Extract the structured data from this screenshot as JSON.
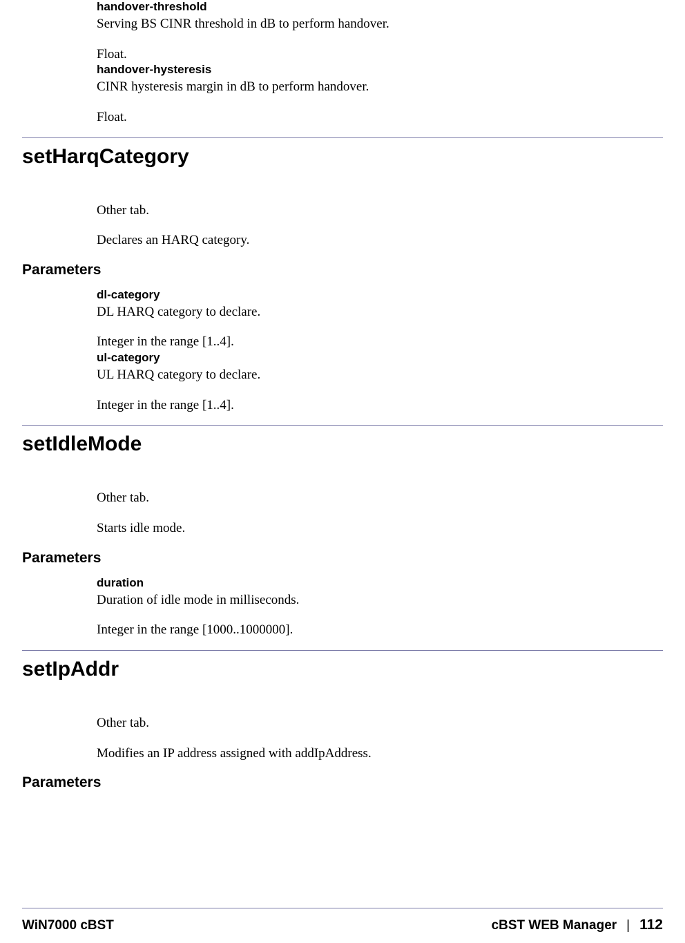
{
  "intro_params": [
    {
      "name": "handover-threshold",
      "desc": "Serving BS CINR threshold in dB to perform handover.",
      "type": "Float."
    },
    {
      "name": "handover-hysteresis",
      "desc": "CINR hysteresis margin in dB to perform handover.",
      "type": "Float."
    }
  ],
  "sections": [
    {
      "title": "setHarqCategory",
      "intro": [
        "Other tab.",
        "Declares an HARQ category."
      ],
      "params_heading": "Parameters",
      "params": [
        {
          "name": "dl-category",
          "desc": "DL HARQ category to declare.",
          "type": "Integer in the range [1..4]."
        },
        {
          "name": "ul-category",
          "desc": "UL HARQ category to declare.",
          "type": "Integer in the range [1..4]."
        }
      ]
    },
    {
      "title": "setIdleMode",
      "intro": [
        "Other tab.",
        "Starts idle mode."
      ],
      "params_heading": "Parameters",
      "params": [
        {
          "name": "duration",
          "desc": "Duration of idle mode in milliseconds.",
          "type": "Integer in the range [1000..1000000]."
        }
      ]
    },
    {
      "title": "setIpAddr",
      "intro": [
        "Other tab.",
        "Modifies an IP address assigned with addIpAddress."
      ],
      "params_heading": "Parameters",
      "params": []
    }
  ],
  "footer": {
    "left": "WiN7000 cBST",
    "right_label": "cBST WEB Manager",
    "sep": "|",
    "page": "112"
  }
}
